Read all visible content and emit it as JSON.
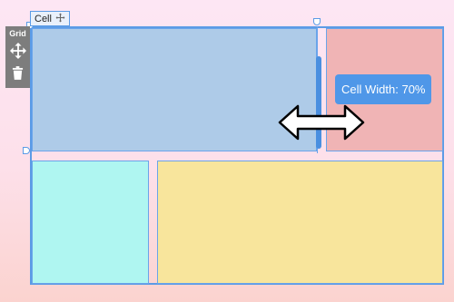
{
  "grid_label": "Cell",
  "toolbar": {
    "title": "Grid",
    "move_icon": "move-arrows-icon",
    "delete_icon": "trash-icon"
  },
  "tooltip": "Cell Width: 70%",
  "cells": [
    {
      "name": "cell-top-left",
      "color": "#aecbe8"
    },
    {
      "name": "cell-top-right",
      "color": "#f0b4b5"
    },
    {
      "name": "cell-bottom-left",
      "color": "#aff6f1"
    },
    {
      "name": "cell-bottom-right",
      "color": "#f8e59c"
    }
  ],
  "colors": {
    "accent": "#5b9be6",
    "toolbar": "#7d7d7d"
  }
}
